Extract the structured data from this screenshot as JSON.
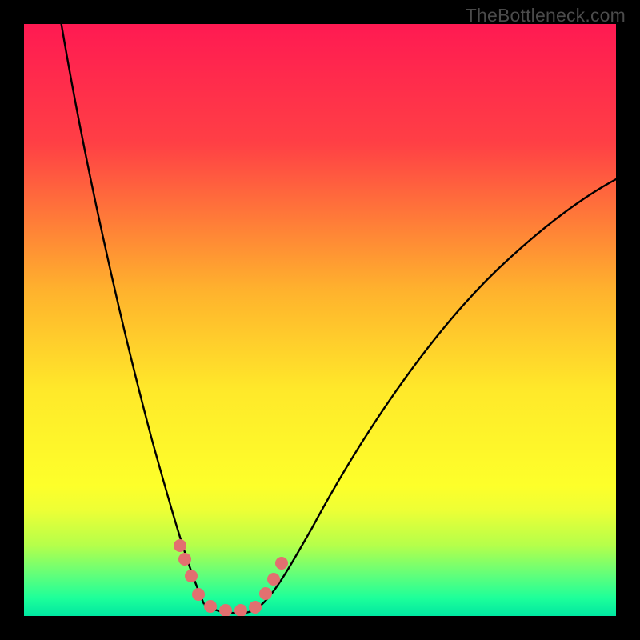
{
  "watermark": "TheBottleneck.com",
  "chart_data": {
    "type": "line",
    "title": "",
    "xlabel": "",
    "ylabel": "",
    "xlim": [
      0,
      100
    ],
    "ylim": [
      0,
      100
    ],
    "background_gradient": {
      "stops": [
        {
          "pct": 0,
          "color": "#ff1a52"
        },
        {
          "pct": 20,
          "color": "#ff3f45"
        },
        {
          "pct": 45,
          "color": "#ffb22d"
        },
        {
          "pct": 62,
          "color": "#ffe92a"
        },
        {
          "pct": 78,
          "color": "#fdff2a"
        },
        {
          "pct": 82,
          "color": "#eeff35"
        },
        {
          "pct": 88,
          "color": "#b6ff4a"
        },
        {
          "pct": 93,
          "color": "#62ff7a"
        },
        {
          "pct": 97,
          "color": "#1dff9a"
        },
        {
          "pct": 100,
          "color": "#00e7a1"
        }
      ]
    },
    "series": [
      {
        "name": "bottleneck-curve",
        "type": "line",
        "x": [
          6,
          10,
          14,
          18,
          22,
          25,
          27,
          28.5,
          30,
          36,
          42,
          50,
          58,
          66,
          74,
          82,
          90,
          98
        ],
        "y": [
          100,
          80,
          60,
          40,
          22,
          10,
          4,
          1,
          0,
          0,
          0,
          8,
          20,
          34,
          48,
          60,
          70,
          75
        ]
      }
    ],
    "markers": {
      "name": "highlight-dots",
      "color": "#e27070",
      "x": [
        25.2,
        26.0,
        27.0,
        29.0,
        31.5,
        34.0,
        36.5,
        39.0,
        41.0,
        42.5,
        44.0
      ],
      "y": [
        8.5,
        6.0,
        3.8,
        1.2,
        0.5,
        0.4,
        0.4,
        1.0,
        3.0,
        5.5,
        8.0
      ]
    },
    "bottom_band": {
      "y_from": 0,
      "y_to": 2.5,
      "color": "#00e7a1"
    }
  }
}
